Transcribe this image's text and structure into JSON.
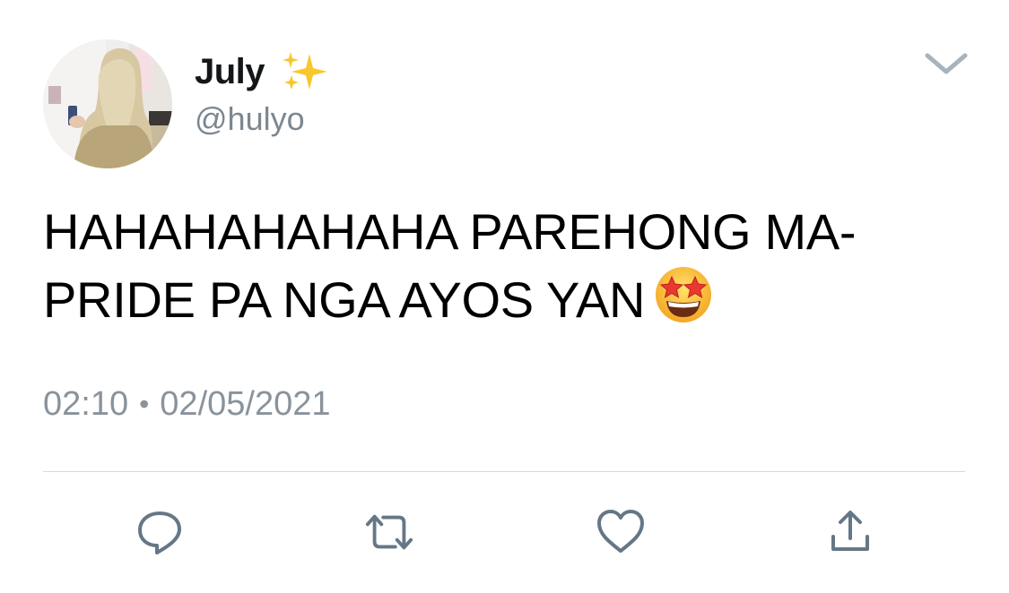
{
  "tweet": {
    "display_name": "July",
    "handle": "@hulyo",
    "name_emoji": "sparkles-icon",
    "text_lines": [
      "HAHAHAHAHAHA PAREHONG MA-",
      "PRIDE PA NGA AYOS YAN"
    ],
    "text_emoji": "star-struck-emoji",
    "time": "02:10",
    "separator": "•",
    "date": "02/05/2021"
  },
  "actions": {
    "reply_icon": "reply-icon",
    "retweet_icon": "retweet-icon",
    "like_icon": "heart-icon",
    "share_icon": "share-icon"
  },
  "colors": {
    "icon_gray": "#657786",
    "secondary_text": "#8a939b",
    "divider": "#d4d8dc",
    "sparkle_yellow": "#f7c82d"
  }
}
